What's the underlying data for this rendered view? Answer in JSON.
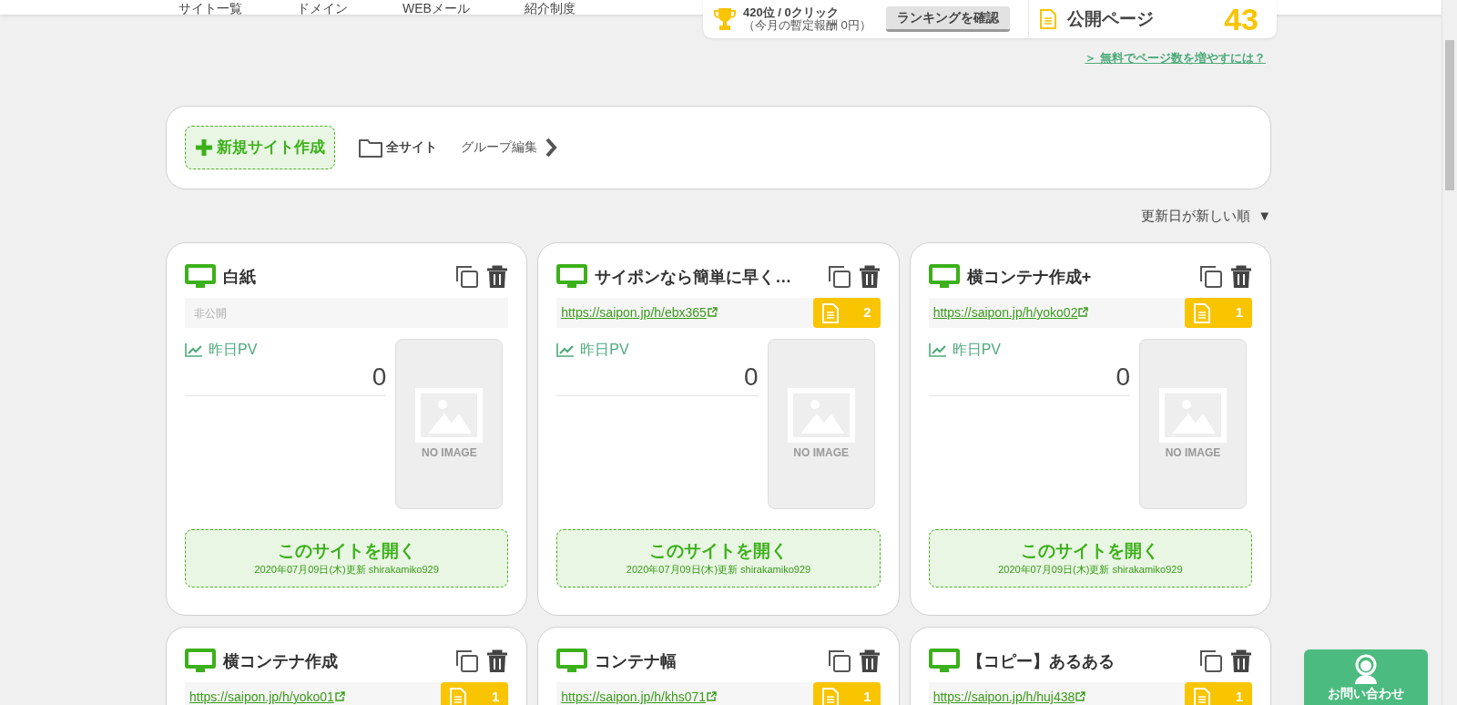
{
  "nav": [
    {
      "label": "サイト一覧"
    },
    {
      "label": "ドメイン"
    },
    {
      "label": "WEBメール"
    },
    {
      "label": "紹介制度"
    }
  ],
  "ranking": {
    "rank": "420位 / 0クリック",
    "reward": "（今月の暫定報酬 0円）",
    "button": "ランキングを確認"
  },
  "public_pages": {
    "label": "公開ページ",
    "count": "43"
  },
  "upgrade_link": "＞ 無料でページ数を増やすには？",
  "toolbar": {
    "new_site": "新規サイト作成",
    "all_sites": "全サイト",
    "group_edit": "グループ編集"
  },
  "sort": {
    "label": "更新日が新しい順",
    "arrow": "▼"
  },
  "sites": [
    {
      "kind": "private",
      "title": "白紙",
      "status": "非公開",
      "pv_label": "昨日PV",
      "pv": "0",
      "thumbnail": "NO IMAGE",
      "open": "このサイトを開く",
      "updated": "2020年07月09日(木)更新 shirakamiko929"
    },
    {
      "kind": "public",
      "title": "サイポンなら簡単に早く…",
      "url": "https://saipon.jp/h/ebx365",
      "pages": "2",
      "pv_label": "昨日PV",
      "pv": "0",
      "thumbnail": "NO IMAGE",
      "open": "このサイトを開く",
      "updated": "2020年07月09日(木)更新 shirakamiko929"
    },
    {
      "kind": "public",
      "title": "横コンテナ作成+",
      "url": "https://saipon.jp/h/yoko02",
      "pages": "1",
      "pv_label": "昨日PV",
      "pv": "0",
      "thumbnail": "NO IMAGE",
      "open": "このサイトを開く",
      "updated": "2020年07月09日(木)更新 shirakamiko929"
    },
    {
      "kind": "public",
      "title": "横コンテナ作成",
      "url": "https://saipon.jp/h/yoko01",
      "pages": "1"
    },
    {
      "kind": "public",
      "title": "コンテナ幅",
      "url": "https://saipon.jp/h/khs071",
      "pages": "1"
    },
    {
      "kind": "public",
      "title": "【コピー】あるある",
      "url": "https://saipon.jp/h/huj438",
      "pages": "1"
    }
  ],
  "contact": {
    "label": "お問い合わせ"
  }
}
